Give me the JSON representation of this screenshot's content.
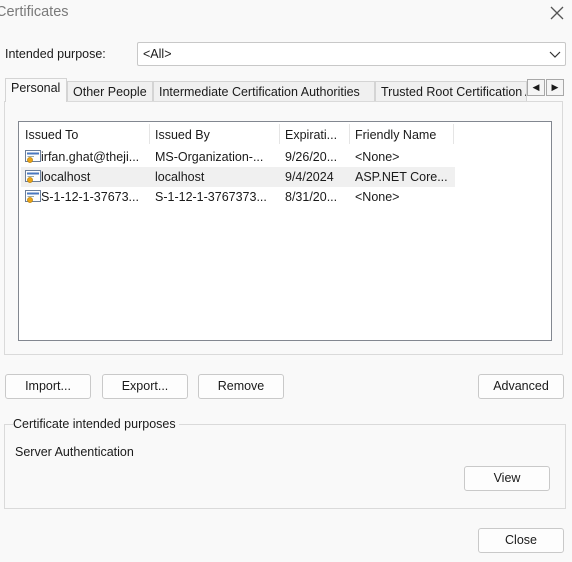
{
  "window": {
    "title": "Certificates",
    "close_icon": "close-icon"
  },
  "purpose": {
    "label": "Intended purpose:",
    "value": "<All>"
  },
  "tabs": [
    {
      "label": "Personal",
      "active": true
    },
    {
      "label": "Other People",
      "active": false
    },
    {
      "label": "Intermediate Certification Authorities",
      "active": false
    },
    {
      "label": "Trusted Root Certification Authorities",
      "active": false
    }
  ],
  "tab_scroll": {
    "left": "◀",
    "right": "▶"
  },
  "list": {
    "columns": [
      "Issued To",
      "Issued By",
      "Expirati...",
      "Friendly Name"
    ],
    "rows": [
      {
        "issued_to": "irfan.ghat@theji...",
        "issued_by": "MS-Organization-...",
        "expiration": "9/26/20...",
        "friendly_name": "<None>",
        "icon": "certificate-icon",
        "selected": false
      },
      {
        "issued_to": "localhost",
        "issued_by": "localhost",
        "expiration": "9/4/2024",
        "friendly_name": "ASP.NET Core...",
        "icon": "certificate-icon",
        "selected": true
      },
      {
        "issued_to": "S-1-12-1-37673...",
        "issued_by": "S-1-12-1-3767373...",
        "expiration": "8/31/20...",
        "friendly_name": "<None>",
        "icon": "certificate-icon",
        "selected": false
      }
    ]
  },
  "buttons": {
    "import": "Import...",
    "export": "Export...",
    "remove": "Remove",
    "advanced": "Advanced",
    "view": "View",
    "close": "Close"
  },
  "intended_purposes": {
    "title": "Certificate intended purposes",
    "text": "Server Authentication"
  }
}
